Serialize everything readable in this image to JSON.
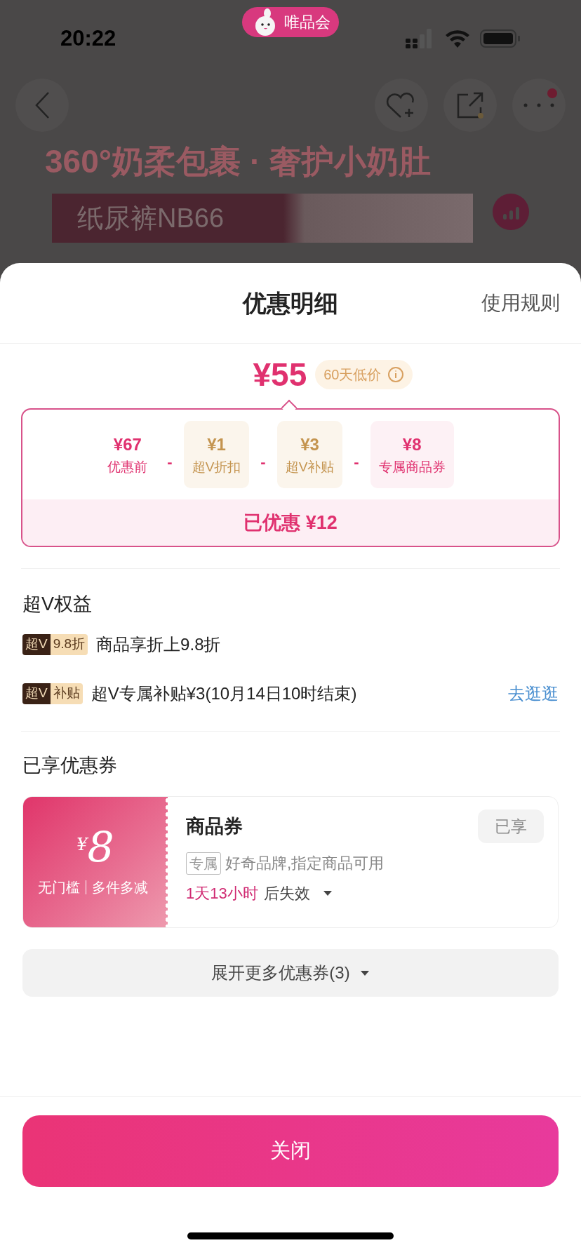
{
  "status_bar": {
    "time": "20:22",
    "app_badge": "唯品会"
  },
  "background_page": {
    "headline": "360°奶柔包裹 · 奢护小奶肚",
    "banner_label": "纸尿裤NB66",
    "more_menu_dot": true
  },
  "sheet": {
    "title": "优惠明细",
    "rules_link": "使用规则",
    "final_price": "¥55",
    "price_tag": "60天低价",
    "breakdown": [
      {
        "kind": "base",
        "amount": "¥67",
        "label": "优惠前"
      },
      {
        "kind": "vip",
        "operator": "-",
        "amount": "¥1",
        "label": "超V折扣"
      },
      {
        "kind": "vip",
        "operator": "-",
        "amount": "¥3",
        "label": "超V补贴"
      },
      {
        "kind": "coupon",
        "operator": "-",
        "amount": "¥8",
        "label": "专属商品券"
      }
    ],
    "total_saved": "已优惠 ¥12"
  },
  "vip_section": {
    "title": "超V权益",
    "benefits": [
      {
        "badge_main": "超V",
        "badge_tag": "9.8折",
        "text": "商品享折上9.8折"
      },
      {
        "badge_main": "超V",
        "badge_tag": "补贴",
        "text": "超V专属补贴¥3(10月14日10时结束)",
        "action": "去逛逛"
      }
    ]
  },
  "coupon_section": {
    "title": "已享优惠券",
    "coupons": [
      {
        "currency": "¥",
        "amount": "8",
        "conditions": [
          "无门槛",
          "多件多减"
        ],
        "name": "商品券",
        "status": "已享",
        "disabled": true,
        "tag": "专属",
        "description": "好奇品牌,指定商品可用",
        "countdown": "1天13小时",
        "expiry_suffix": "后失效"
      }
    ],
    "expand_button": "展开更多优惠券(3)"
  },
  "close_button": "关闭"
}
